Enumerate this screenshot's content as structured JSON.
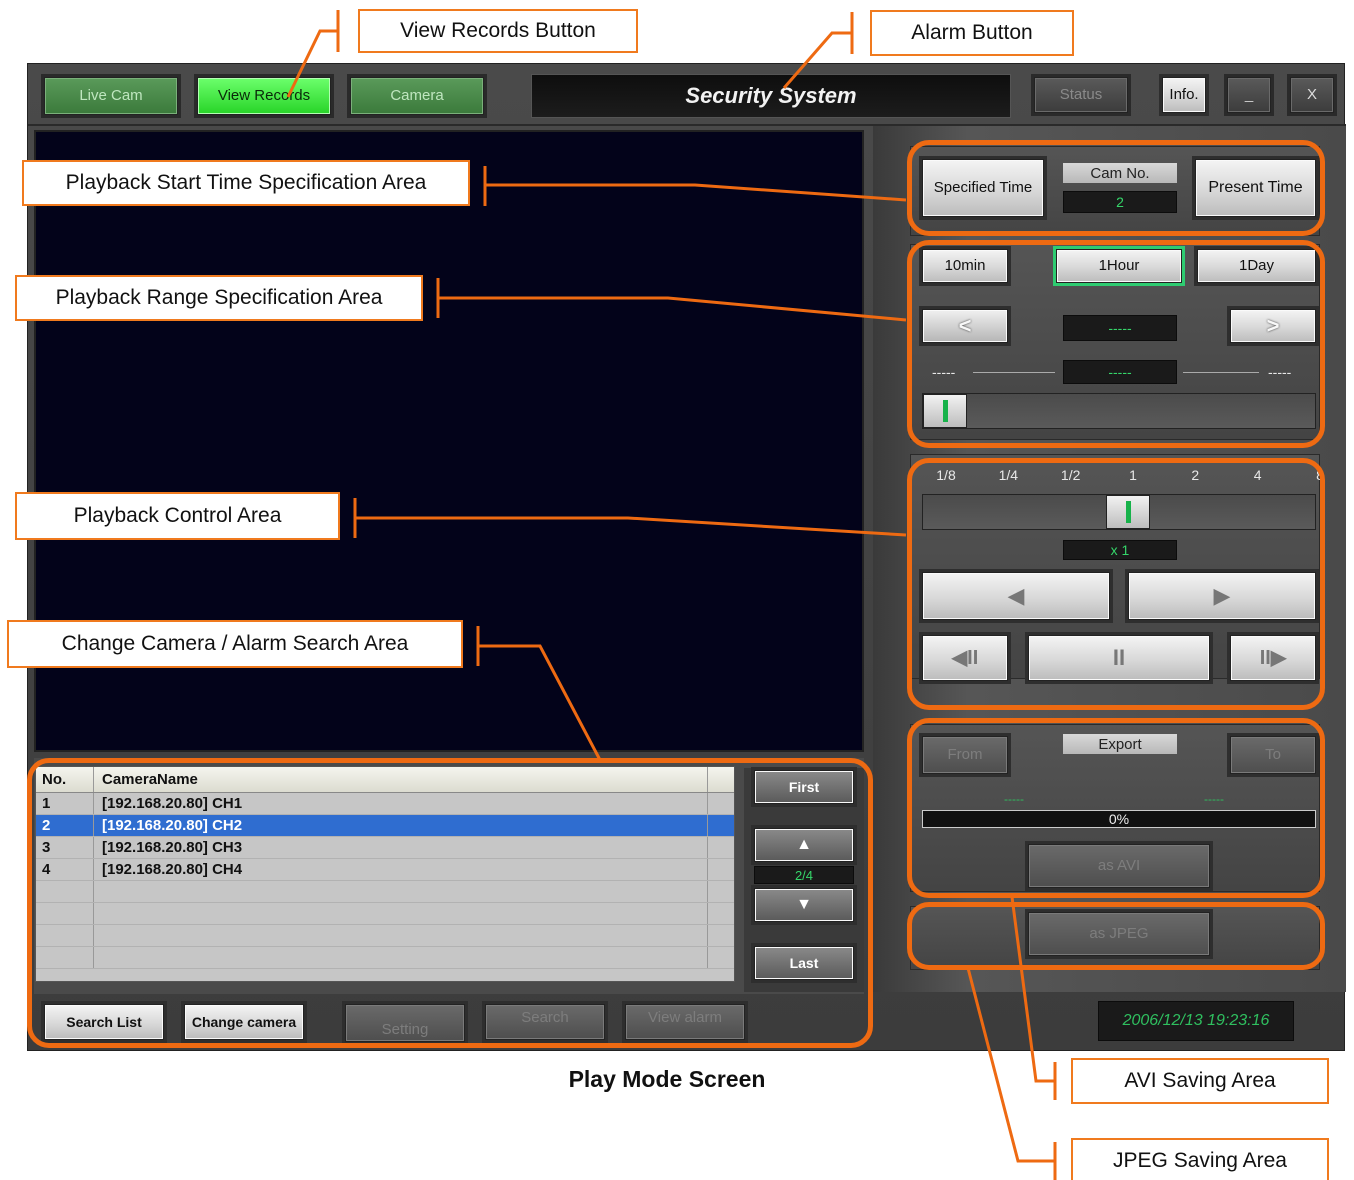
{
  "toolbar": {
    "live_cam": "Live Cam",
    "view_records": "View Records",
    "camera": "Camera",
    "title": "Security System",
    "status": "Status",
    "info": "Info.",
    "minimize": "_",
    "close": "X"
  },
  "start_time": {
    "specified_time": "Specified Time",
    "cam_no_label": "Cam No.",
    "cam_no_value": "2",
    "present_time": "Present Time"
  },
  "range": {
    "btn_10min": "10min",
    "btn_1hour": "1Hour",
    "btn_1day": "1Day",
    "selected": "1Hour",
    "prev": "<",
    "next": ">",
    "current_display": "-----",
    "left_time": "-----",
    "center_time": "-----",
    "right_time": "-----",
    "slider_position": 0.0
  },
  "control": {
    "speed_ticks": [
      "1/8",
      "1/4",
      "1/2",
      "1",
      "2",
      "4",
      "8"
    ],
    "speed_selected": "1",
    "speed_display": "x 1",
    "rewind": "◀",
    "play": "▶",
    "step_back": "◀II",
    "pause": "II",
    "step_forward": "II▶"
  },
  "export": {
    "label": "Export",
    "from": "From",
    "to": "To",
    "from_time": "-----",
    "to_time": "-----",
    "progress": "0%",
    "progress_value": 0,
    "as_avi": "as AVI",
    "as_jpeg": "as JPEG"
  },
  "camera_list": {
    "col_no": "No.",
    "col_name": "CameraName",
    "rows": [
      {
        "no": "1",
        "name": "[192.168.20.80] CH1"
      },
      {
        "no": "2",
        "name": "[192.168.20.80] CH2"
      },
      {
        "no": "3",
        "name": "[192.168.20.80] CH3"
      },
      {
        "no": "4",
        "name": "[192.168.20.80] CH4"
      }
    ],
    "selected_no": "2",
    "first": "First",
    "up": "▲",
    "page": "2/4",
    "down": "▼",
    "last": "Last"
  },
  "bottom_bar": {
    "search_list": "Search List",
    "change_camera": "Change camera",
    "setting": "Setting",
    "search": "Search",
    "view_alarm": "View alarm",
    "datetime": "2006/12/13 19:23:16"
  },
  "annotations": {
    "view_records_button": "View Records Button",
    "alarm_button": "Alarm Button",
    "start_time_area": "Playback Start Time Specification Area",
    "range_area": "Playback Range Specification Area",
    "control_area": "Playback Control Area",
    "camera_area": "Change Camera / Alarm Search Area",
    "caption": "Play Mode Screen",
    "avi_area": "AVI Saving Area",
    "jpeg_area": "JPEG Saving Area"
  },
  "colors": {
    "accent_orange": "#ee6a12",
    "lcd_green": "#35d66a",
    "video_bg": "#03031a",
    "selection_blue": "#2f6dd0"
  }
}
